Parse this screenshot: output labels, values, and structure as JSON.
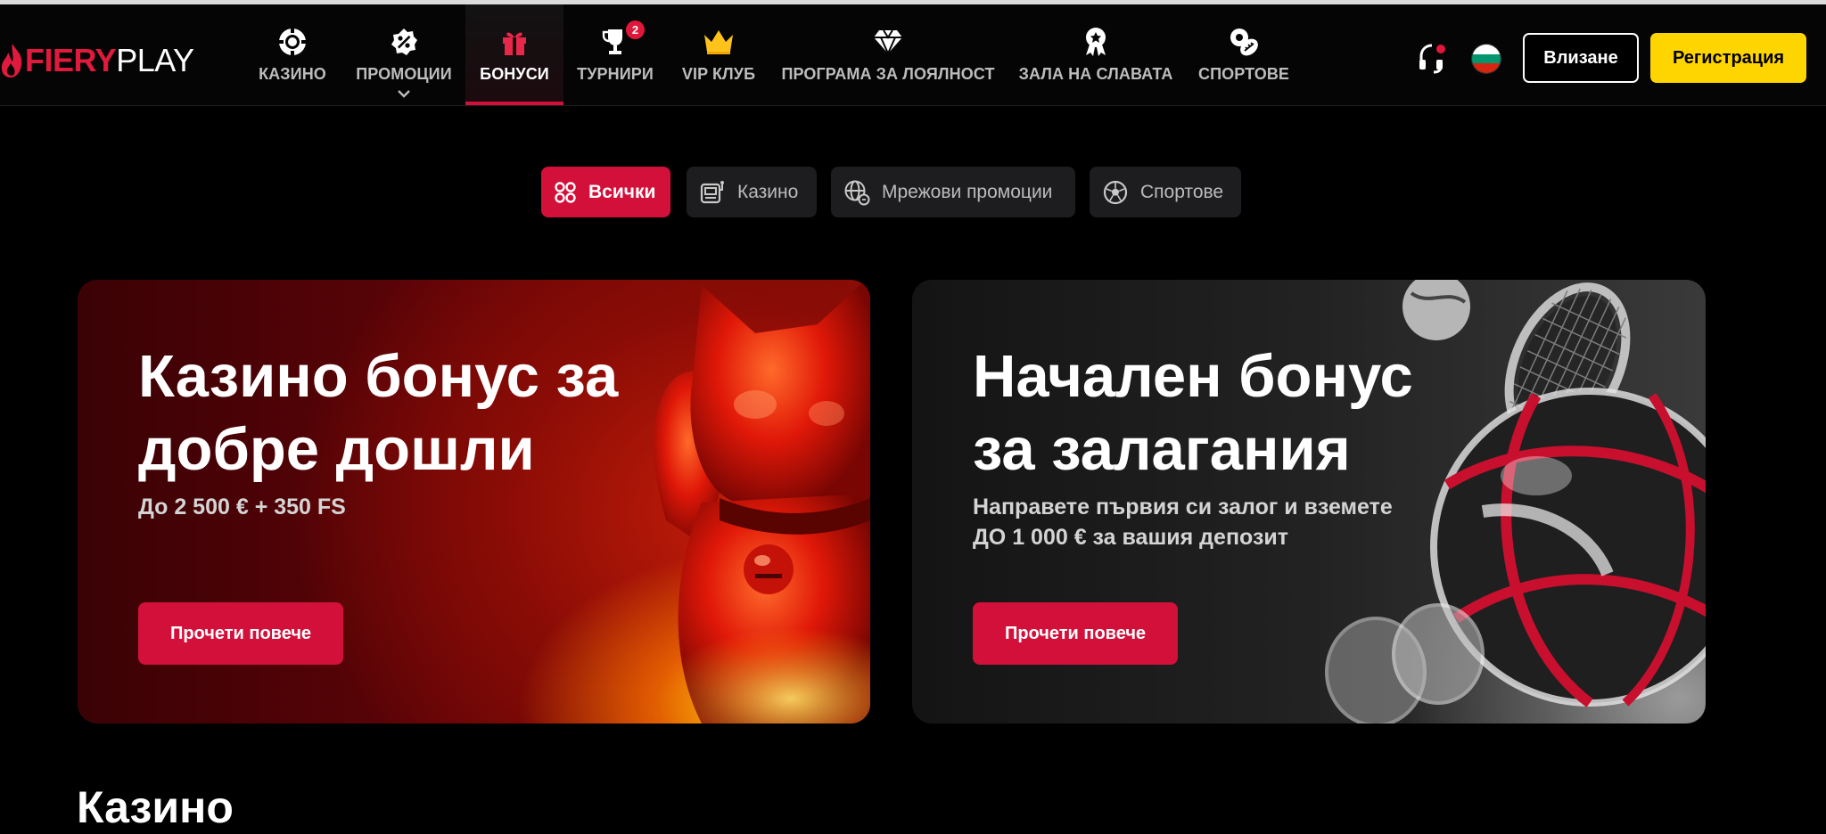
{
  "brand": {
    "logo_part1": "FIERY",
    "logo_part2": "PLAY",
    "accent": "#d2103a",
    "cta_yellow": "#ffd500"
  },
  "nav": [
    {
      "label": "КАЗИНО",
      "icon": "casino-chip-icon"
    },
    {
      "label": "ПРОМОЦИИ",
      "icon": "promo-percent-icon",
      "has_dropdown": true
    },
    {
      "label": "БОНУСИ",
      "icon": "gift-icon",
      "active": true
    },
    {
      "label": "ТУРНИРИ",
      "icon": "trophy-icon",
      "badge": "2"
    },
    {
      "label": "VIP КЛУБ",
      "icon": "crown-icon"
    },
    {
      "label": "ПРОГРАМА ЗА ЛОЯЛНОСТ",
      "icon": "diamond-icon"
    },
    {
      "label": "ЗАЛА НА СЛАВАТА",
      "icon": "medal-icon"
    },
    {
      "label": "СПОРТОВЕ",
      "icon": "sports-balls-icon"
    }
  ],
  "header_actions": {
    "support_icon": "headset-icon",
    "language_flag": "bulgaria-flag",
    "login_label": "Влизане",
    "register_label": "Регистрация"
  },
  "filters": [
    {
      "label": "Всички",
      "icon": "grid-icon",
      "active": true
    },
    {
      "label": "Казино",
      "icon": "slot-machine-icon"
    },
    {
      "label": "Мрежови промоции",
      "icon": "globe-icon"
    },
    {
      "label": "Спортове",
      "icon": "football-icon"
    }
  ],
  "cards": [
    {
      "title_line1": "Казино бонус за",
      "title_line2": "добре дошли",
      "subtitle_line1": "До 2 500 € + 350 FS",
      "subtitle_line2": "",
      "button": "Прочети повече"
    },
    {
      "title_line1": "Начален бонус",
      "title_line2": "за залагания",
      "subtitle_line1": "Направете първия си залог и вземете",
      "subtitle_line2": "ДО 1 000 € за вашия депозит",
      "button": "Прочети повече"
    }
  ],
  "section_heading": "Казино"
}
